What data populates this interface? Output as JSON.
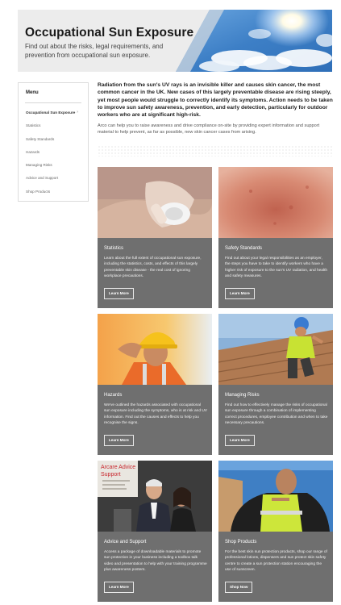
{
  "header": {
    "title": "Occupational Sun Exposure",
    "subtitle": "Find out about the risks, legal requirements, and prevention from occupational sun exposure."
  },
  "menu": {
    "title": "Menu",
    "items": [
      {
        "label": "Occupational Sun Exposure",
        "active": true
      },
      {
        "label": "Statistics"
      },
      {
        "label": "Safety Standards"
      },
      {
        "label": "Hazards"
      },
      {
        "label": "Managing Risks"
      },
      {
        "label": "Advice and Support"
      },
      {
        "label": "Shop Products"
      }
    ],
    "active_chevron": "›"
  },
  "intro": {
    "lead": "Radiation from the sun's UV rays is an invisible killer and causes skin cancer, the most common cancer in the UK. New cases of this largely preventable disease are rising steeply, yet most people would struggle to correctly identify its symptoms. Action needs to be taken to improve sun safety awareness, prevention, and early detection, particularly for outdoor workers who are at significant high-risk.",
    "body": "Arco can help you to raise awareness and drive compliance on-site by providing expert information and support material to help prevent, as far as possible, new skin cancer cases from arising."
  },
  "cards": [
    {
      "title": "Statistics",
      "text": "Learn about the full extent of occupational sun exposure, including the statistics, costs, and effects of this largely preventable skin disease - the real cost of ignoring workplace precautions.",
      "button": "Learn More"
    },
    {
      "title": "Safety Standards",
      "text": "Find out about your legal responsibilities as an employer, the steps you have to take to identify workers who have a higher risk of exposure to the sun's UV radiation, and health and safety measures.",
      "button": "Learn More"
    },
    {
      "title": "Hazards",
      "text": "We've outlined the hazards associated with occupational sun exposure including the symptoms, who is at risk and UV information. Find out the causes and effects to help you recognise the signs.",
      "button": "Learn More"
    },
    {
      "title": "Managing Risks",
      "text": "Find out how to effectively manage the risks of occupational sun exposure through a combination of implementing correct procedures, employee contribution and when to take necessary precautions.",
      "button": "Learn More"
    },
    {
      "title": "Advice and Support",
      "text": "Access a package of downloadable materials to promote sun protection in your business including a toolbox talk video and presentation to help with your training programme plus awareness posters.",
      "button": "Learn More",
      "photo_sign_text": "Arcare Advice Support"
    },
    {
      "title": "Shop Products",
      "text": "For the best skin sun protection products, shop our range of professional lotions, dispensers and sun protect skin safety centre to create a sun protection station encouraging the use of sunscreen.",
      "button": "Shop Now"
    }
  ],
  "colors": {
    "card_bg": "#6f6f6f",
    "banner_bg": "#ececec",
    "sky_blue": "#3f7fc4"
  }
}
